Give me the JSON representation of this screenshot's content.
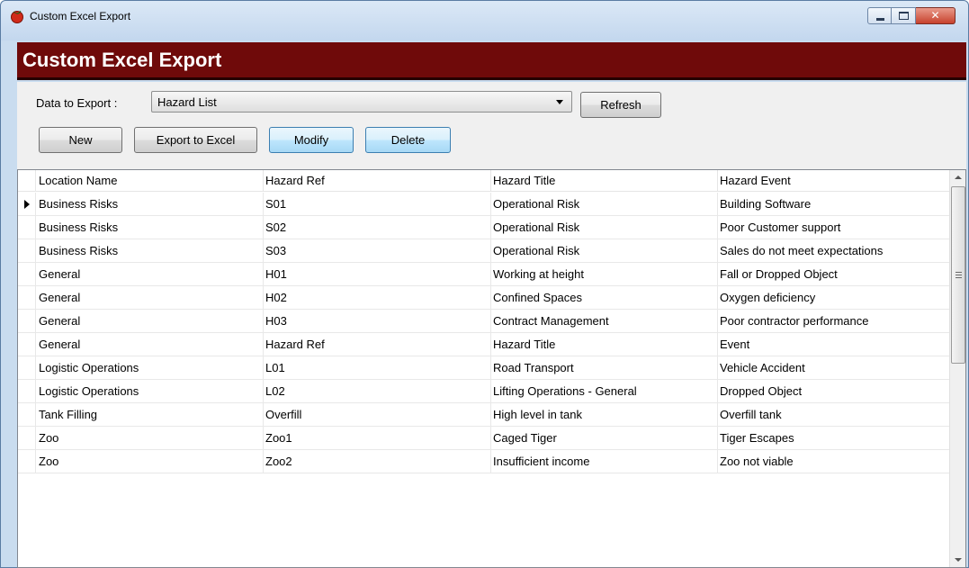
{
  "window": {
    "title": "Custom Excel Export"
  },
  "banner": {
    "title": "Custom Excel Export"
  },
  "toolbar": {
    "data_label": "Data to Export :",
    "data_value": "Hazard List",
    "refresh_label": "Refresh",
    "new_label": "New",
    "export_label": "Export to Excel",
    "modify_label": "Modify",
    "delete_label": "Delete"
  },
  "grid": {
    "columns": [
      "Location Name",
      "Hazard Ref",
      "Hazard Title",
      "Hazard Event"
    ],
    "rows": [
      [
        "Business Risks",
        "S01",
        "Operational Risk",
        "Building Software"
      ],
      [
        "Business Risks",
        "S02",
        "Operational Risk",
        "Poor Customer support"
      ],
      [
        "Business Risks",
        "S03",
        "Operational Risk",
        "Sales do not meet expectations"
      ],
      [
        "General",
        "H01",
        "Working at height",
        "Fall or Dropped Object"
      ],
      [
        "General",
        "H02",
        "Confined Spaces",
        "Oxygen deficiency"
      ],
      [
        "General",
        "H03",
        "Contract Management",
        "Poor contractor performance"
      ],
      [
        "General",
        "Hazard Ref",
        "Hazard Title",
        "Event"
      ],
      [
        "Logistic Operations",
        "L01",
        "Road Transport",
        "Vehicle Accident"
      ],
      [
        "Logistic Operations",
        "L02",
        "Lifting Operations - General",
        "Dropped Object"
      ],
      [
        "Tank Filling",
        "Overfill",
        "High level in tank",
        "Overfill tank"
      ],
      [
        "Zoo",
        "Zoo1",
        "Caged Tiger",
        "Tiger Escapes"
      ],
      [
        "Zoo",
        "Zoo2",
        "Insufficient income",
        "Zoo not viable"
      ]
    ],
    "current_row": 0
  },
  "icons": {
    "app": "apple-icon",
    "minimize": "minimize-icon",
    "maximize": "maximize-icon",
    "close": "close-icon",
    "dropdown": "chevron-down-icon",
    "row_pointer": "row-pointer-icon"
  },
  "colors": {
    "banner": "#6f0a0a",
    "title_bar": "#c9dcef",
    "close_button": "#c7422d",
    "highlight_button": "#bee6fd"
  }
}
